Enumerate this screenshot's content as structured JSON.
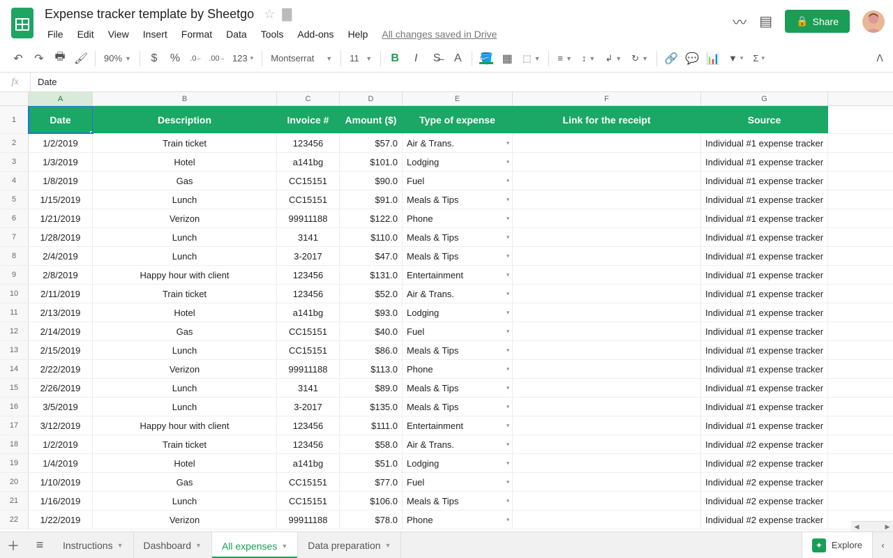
{
  "doc": {
    "title": "Expense tracker template by Sheetgo",
    "save_status": "All changes saved in Drive"
  },
  "menus": [
    "File",
    "Edit",
    "View",
    "Insert",
    "Format",
    "Data",
    "Tools",
    "Add-ons",
    "Help"
  ],
  "share_label": "Share",
  "toolbar": {
    "zoom": "90%",
    "currency": "$",
    "percent": "%",
    "dec_dec": ".0",
    "dec_inc": ".00",
    "more_fmt": "123",
    "font": "Montserrat",
    "font_size": "11"
  },
  "formula": {
    "fx": "fx",
    "value": "Date"
  },
  "columns": [
    "A",
    "B",
    "C",
    "D",
    "E",
    "F",
    "G"
  ],
  "col_classes": [
    "cA",
    "cB",
    "cC",
    "cD",
    "cE",
    "cF",
    "cG"
  ],
  "header_row": [
    "Date",
    "Description",
    "Invoice #",
    "Amount ($)",
    "Type of expense",
    "Link for the receipt",
    "Source"
  ],
  "rows": [
    {
      "n": 2,
      "date": "1/2/2019",
      "desc": "Train ticket",
      "inv": "123456",
      "amt": "$57.0",
      "type": "Air & Trans.",
      "link": "",
      "src": "Individual #1 expense tracker"
    },
    {
      "n": 3,
      "date": "1/3/2019",
      "desc": "Hotel",
      "inv": "a141bg",
      "amt": "$101.0",
      "type": "Lodging",
      "link": "",
      "src": "Individual #1 expense tracker"
    },
    {
      "n": 4,
      "date": "1/8/2019",
      "desc": "Gas",
      "inv": "CC15151",
      "amt": "$90.0",
      "type": "Fuel",
      "link": "",
      "src": "Individual #1 expense tracker"
    },
    {
      "n": 5,
      "date": "1/15/2019",
      "desc": "Lunch",
      "inv": "CC15151",
      "amt": "$91.0",
      "type": "Meals & Tips",
      "link": "",
      "src": "Individual #1 expense tracker"
    },
    {
      "n": 6,
      "date": "1/21/2019",
      "desc": "Verizon",
      "inv": "99911188",
      "amt": "$122.0",
      "type": "Phone",
      "link": "",
      "src": "Individual #1 expense tracker"
    },
    {
      "n": 7,
      "date": "1/28/2019",
      "desc": "Lunch",
      "inv": "3141",
      "amt": "$110.0",
      "type": "Meals & Tips",
      "link": "",
      "src": "Individual #1 expense tracker"
    },
    {
      "n": 8,
      "date": "2/4/2019",
      "desc": "Lunch",
      "inv": "3-2017",
      "amt": "$47.0",
      "type": "Meals & Tips",
      "link": "",
      "src": "Individual #1 expense tracker"
    },
    {
      "n": 9,
      "date": "2/8/2019",
      "desc": "Happy hour with client",
      "inv": "123456",
      "amt": "$131.0",
      "type": "Entertainment",
      "link": "",
      "src": "Individual #1 expense tracker"
    },
    {
      "n": 10,
      "date": "2/11/2019",
      "desc": "Train ticket",
      "inv": "123456",
      "amt": "$52.0",
      "type": "Air & Trans.",
      "link": "",
      "src": "Individual #1 expense tracker"
    },
    {
      "n": 11,
      "date": "2/13/2019",
      "desc": "Hotel",
      "inv": "a141bg",
      "amt": "$93.0",
      "type": "Lodging",
      "link": "",
      "src": "Individual #1 expense tracker"
    },
    {
      "n": 12,
      "date": "2/14/2019",
      "desc": "Gas",
      "inv": "CC15151",
      "amt": "$40.0",
      "type": "Fuel",
      "link": "",
      "src": "Individual #1 expense tracker"
    },
    {
      "n": 13,
      "date": "2/15/2019",
      "desc": "Lunch",
      "inv": "CC15151",
      "amt": "$86.0",
      "type": "Meals & Tips",
      "link": "",
      "src": "Individual #1 expense tracker"
    },
    {
      "n": 14,
      "date": "2/22/2019",
      "desc": "Verizon",
      "inv": "99911188",
      "amt": "$113.0",
      "type": "Phone",
      "link": "",
      "src": "Individual #1 expense tracker"
    },
    {
      "n": 15,
      "date": "2/26/2019",
      "desc": "Lunch",
      "inv": "3141",
      "amt": "$89.0",
      "type": "Meals & Tips",
      "link": "",
      "src": "Individual #1 expense tracker"
    },
    {
      "n": 16,
      "date": "3/5/2019",
      "desc": "Lunch",
      "inv": "3-2017",
      "amt": "$135.0",
      "type": "Meals & Tips",
      "link": "",
      "src": "Individual #1 expense tracker"
    },
    {
      "n": 17,
      "date": "3/12/2019",
      "desc": "Happy hour with client",
      "inv": "123456",
      "amt": "$111.0",
      "type": "Entertainment",
      "link": "",
      "src": "Individual #1 expense tracker"
    },
    {
      "n": 18,
      "date": "1/2/2019",
      "desc": "Train ticket",
      "inv": "123456",
      "amt": "$58.0",
      "type": "Air & Trans.",
      "link": "",
      "src": "Individual #2 expense tracker"
    },
    {
      "n": 19,
      "date": "1/4/2019",
      "desc": "Hotel",
      "inv": "a141bg",
      "amt": "$51.0",
      "type": "Lodging",
      "link": "",
      "src": "Individual #2 expense tracker"
    },
    {
      "n": 20,
      "date": "1/10/2019",
      "desc": "Gas",
      "inv": "CC15151",
      "amt": "$77.0",
      "type": "Fuel",
      "link": "",
      "src": "Individual #2 expense tracker"
    },
    {
      "n": 21,
      "date": "1/16/2019",
      "desc": "Lunch",
      "inv": "CC15151",
      "amt": "$106.0",
      "type": "Meals & Tips",
      "link": "",
      "src": "Individual #2 expense tracker"
    },
    {
      "n": 22,
      "date": "1/22/2019",
      "desc": "Verizon",
      "inv": "99911188",
      "amt": "$78.0",
      "type": "Phone",
      "link": "",
      "src": "Individual #2 expense tracker"
    }
  ],
  "tabs": [
    {
      "label": "Instructions",
      "active": false
    },
    {
      "label": "Dashboard",
      "active": false
    },
    {
      "label": "All expenses",
      "active": true
    },
    {
      "label": "Data preparation",
      "active": false
    }
  ],
  "explore_label": "Explore"
}
